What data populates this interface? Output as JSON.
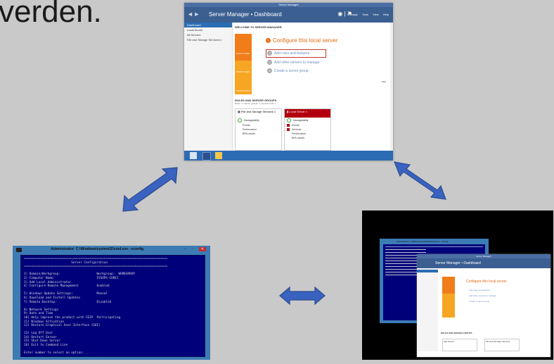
{
  "heading_word": "verden.",
  "server_manager": {
    "titlebar": "Server Manager",
    "nav_arrows": "◄ ►",
    "breadcrumb": "Server Manager • Dashboard",
    "menus": [
      "Manage",
      "Tools",
      "View",
      "Help"
    ],
    "sidebar": [
      "Dashboard",
      "Local Server",
      "All Servers",
      "File and Storage Services ▷"
    ],
    "welcome": "WELCOME TO SERVER MANAGER",
    "tiles": [
      "QUICK START",
      "WHAT'S NEW",
      "LEARN MORE"
    ],
    "configure": "Configure this local server",
    "steps": [
      {
        "num": "2",
        "label": "Add roles and features"
      },
      {
        "num": "3",
        "label": "Add other servers to manage"
      },
      {
        "num": "4",
        "label": "Create a server group"
      }
    ],
    "configure_num": "1",
    "hide": "Hide",
    "groups_title": "ROLES AND SERVER GROUPS",
    "groups_sub": "Roles: 1 | Server groups: 1 | Servers total: 1",
    "cards": [
      {
        "title": "File and Storage Services",
        "count": "1",
        "rows": [
          "Manageability",
          "Events",
          "Performance",
          "BPA results"
        ],
        "color": "#ffffff",
        "text": "#333333"
      },
      {
        "title": "Local Server",
        "count": "1",
        "rows": [
          "Manageability",
          "Events",
          "Services",
          "Performance",
          "BPA results"
        ],
        "color": "#b3000f",
        "text": "#ffffff"
      }
    ]
  },
  "sconfig": {
    "title": "Administrator: C:\\Windows\\system32\\cmd.exe - sconfig",
    "buttons": [
      "–",
      "▫",
      "✕"
    ],
    "lines": [
      "===============================================================================",
      "                          Server Configuration",
      "===============================================================================",
      "",
      "1) Domain/Workgroup:                    Workgroup:  WORKGROUP",
      "2) Computer Name:                       SYSOPS-CORE1",
      "3) Add Local Administrator",
      "4) Configure Remote Management          Enabled",
      "",
      "5) Windows Update Settings:             Manual",
      "6) Download and Install Updates",
      "7) Remote Desktop:                      Disabled",
      "",
      "8) Network Settings",
      "9) Date and Time",
      "10) Help improve the product with CEIP  Participating",
      "11) Windows Activation",
      "12) Restore Graphical User Interface (GUI)",
      "",
      "13) Log Off User",
      "14) Restart Server",
      "15) Shut Down Server",
      "16) Exit to Command Line",
      "",
      "Enter number to select an option: _"
    ]
  },
  "combined": {
    "cmd_title": "Administrator: C:\\Windows\\system32\\cmd.exe - sconfig",
    "sm_title": "Server Manager",
    "breadcrumb": "Server Manager • Dashboard",
    "configure": "Configure this local server",
    "steps": [
      "Add roles and features",
      "Add other servers to manage",
      "Create a server group"
    ],
    "groups_title": "ROLES AND SERVER GROUPS",
    "card_labels": [
      "App Server",
      "File and Storage Services"
    ]
  },
  "colors": {
    "arrow_fill": "#3a62c0",
    "arrow_stroke": "#2a4c8f",
    "accent_orange": "#e8690f",
    "tile_orange": "#f07d1a",
    "tile_yellow": "#f6a623",
    "console_blue": "#00007a"
  }
}
